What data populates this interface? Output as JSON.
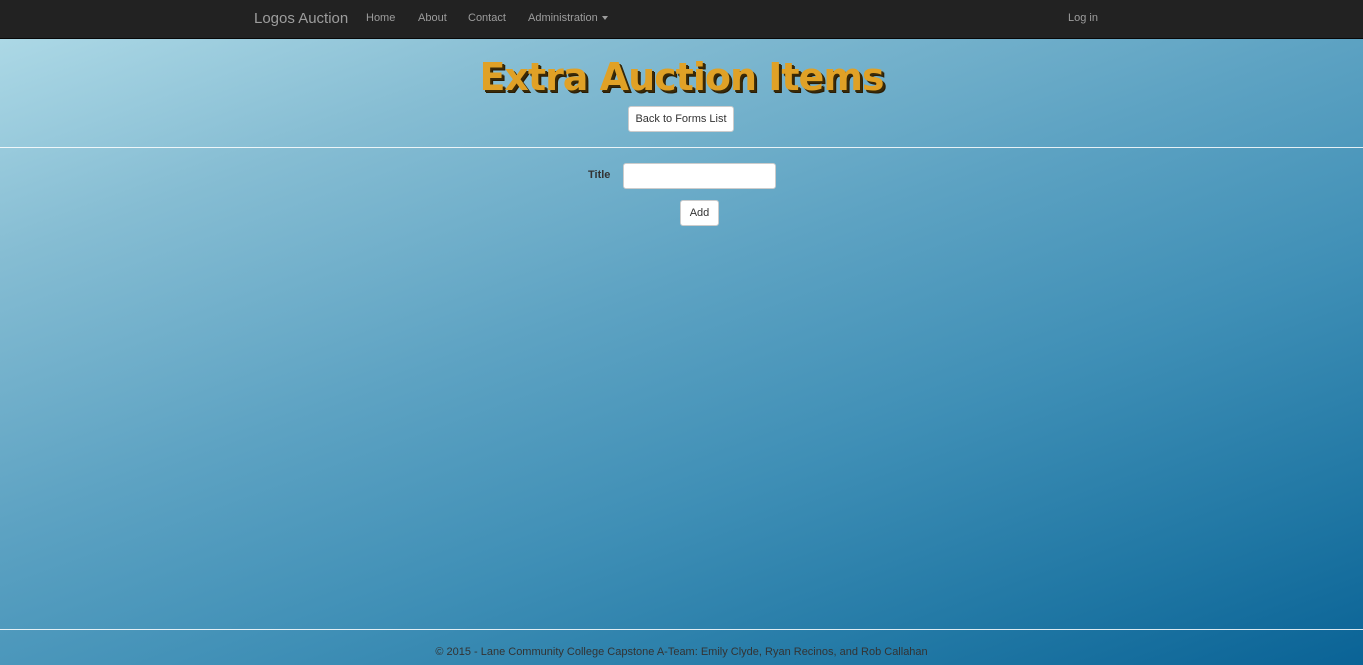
{
  "navbar": {
    "brand": "Logos Auction",
    "items": [
      {
        "label": "Home"
      },
      {
        "label": "About"
      },
      {
        "label": "Contact"
      },
      {
        "label": "Administration"
      }
    ],
    "login": "Log in"
  },
  "page": {
    "title": "Extra Auction Items",
    "back_button": "Back to Forms List"
  },
  "form": {
    "title_label": "Title",
    "title_value": "",
    "add_button": "Add"
  },
  "footer": {
    "text": "© 2015 - Lane Community College Capstone A-Team: Emily Clyde, Ryan Recinos, and Rob Callahan"
  },
  "colors": {
    "navbar_bg": "#222222",
    "nav_text": "#9d9d9d",
    "title_gold": "#e0a126",
    "bg_gradient_start": "#b3dde9",
    "bg_gradient_end": "#0a6396"
  }
}
